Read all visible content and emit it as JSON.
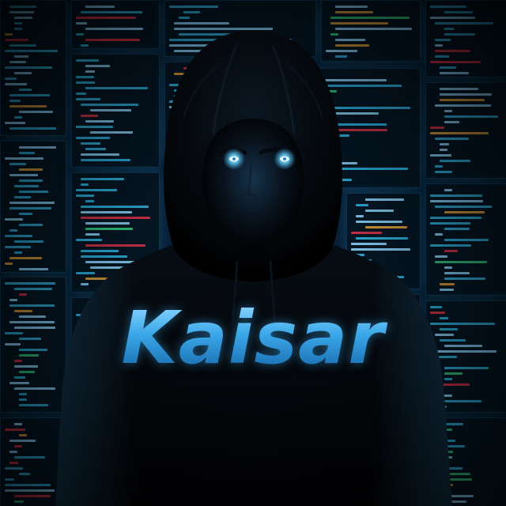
{
  "image": {
    "brand_text": "Kaisar"
  },
  "colors": {
    "background": "#02060c",
    "screen_glow": "#28a0dc",
    "code_primary": "#2fb8e6",
    "code_secondary": "#8fd8ff",
    "code_accent_red": "#e0334a",
    "code_accent_green": "#35d07f",
    "code_accent_orange": "#e8a33a",
    "eye_glow": "#6fd8ff",
    "brand_text": "#3aa7e8"
  },
  "icons": [
    "hooded-figure",
    "code-screen"
  ]
}
